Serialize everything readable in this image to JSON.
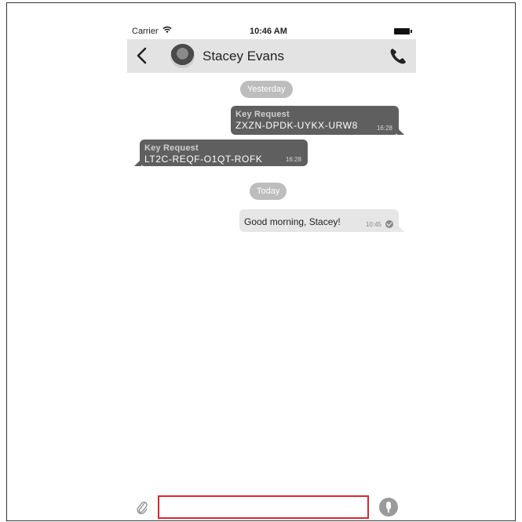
{
  "status_bar": {
    "carrier": "Carrier",
    "time": "10:46 AM"
  },
  "header": {
    "contact_name": "Stacey Evans"
  },
  "chat": {
    "date_yesterday": "Yesterday",
    "date_today": "Today",
    "messages": [
      {
        "direction": "outgoing",
        "title": "Key Request",
        "body": "ZXZN-DPDK-UYKX-URW8",
        "time": "16:28"
      },
      {
        "direction": "incoming",
        "title": "Key Request",
        "body": "LT2C-REQF-O1QT-ROFK",
        "time": "16:28"
      },
      {
        "direction": "outgoing",
        "body": "Good morning, Stacey!",
        "time": "10:45",
        "status": "delivered"
      }
    ]
  },
  "composer": {
    "placeholder": "",
    "value": ""
  },
  "icons": {
    "back": "chevron-left-icon",
    "call": "phone-icon",
    "attach": "paperclip-icon",
    "mic": "microphone-icon",
    "wifi": "wifi-icon",
    "battery": "battery-icon"
  },
  "colors": {
    "outgoing_bubble": "#5f5f5f",
    "incoming_bubble": "#5f5f5f",
    "light_bubble": "#e6e6e6",
    "input_border": "#d9282f",
    "header_bg": "#e3e3e3"
  }
}
